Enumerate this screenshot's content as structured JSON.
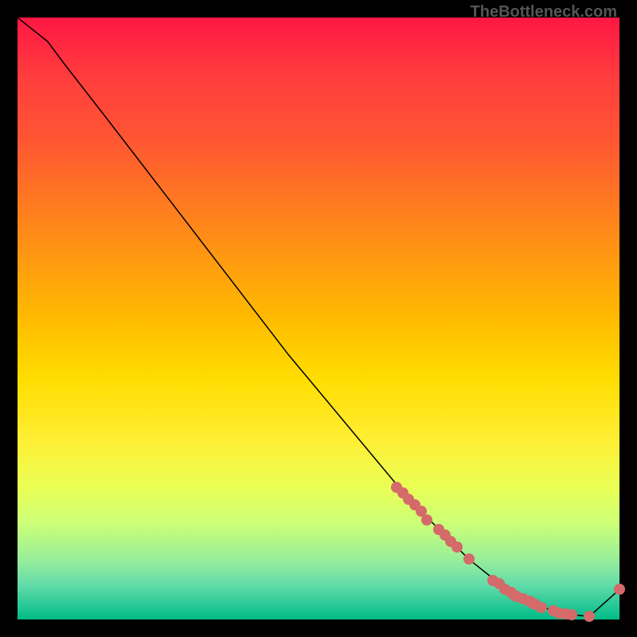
{
  "watermark": "TheBottleneck.com",
  "chart_data": {
    "type": "line",
    "title": "",
    "xlabel": "",
    "ylabel": "",
    "xlim": [
      0,
      100
    ],
    "ylim": [
      0,
      100
    ],
    "curve": {
      "x": [
        0,
        5,
        8,
        15,
        25,
        35,
        45,
        55,
        65,
        75,
        80,
        85,
        90,
        95,
        100
      ],
      "y": [
        100,
        96,
        92,
        83,
        70,
        57,
        44,
        32,
        20,
        10,
        6,
        3,
        1,
        0.5,
        5
      ]
    },
    "dots": [
      {
        "x": 63,
        "y": 22
      },
      {
        "x": 64,
        "y": 21
      },
      {
        "x": 65,
        "y": 20
      },
      {
        "x": 66,
        "y": 19
      },
      {
        "x": 67,
        "y": 18
      },
      {
        "x": 68,
        "y": 16.5
      },
      {
        "x": 70,
        "y": 15
      },
      {
        "x": 71,
        "y": 14
      },
      {
        "x": 72,
        "y": 13
      },
      {
        "x": 73,
        "y": 12
      },
      {
        "x": 75,
        "y": 10
      },
      {
        "x": 79,
        "y": 6.5
      },
      {
        "x": 80,
        "y": 6
      },
      {
        "x": 81,
        "y": 5
      },
      {
        "x": 82,
        "y": 4.5
      },
      {
        "x": 82.5,
        "y": 4
      },
      {
        "x": 83,
        "y": 3.8
      },
      {
        "x": 84,
        "y": 3.4
      },
      {
        "x": 85,
        "y": 3
      },
      {
        "x": 85.5,
        "y": 2.8
      },
      {
        "x": 86,
        "y": 2.5
      },
      {
        "x": 87,
        "y": 2
      },
      {
        "x": 89,
        "y": 1.5
      },
      {
        "x": 90,
        "y": 1
      },
      {
        "x": 91,
        "y": 0.9
      },
      {
        "x": 92,
        "y": 0.8
      },
      {
        "x": 95,
        "y": 0.5
      },
      {
        "x": 100,
        "y": 5
      }
    ]
  }
}
